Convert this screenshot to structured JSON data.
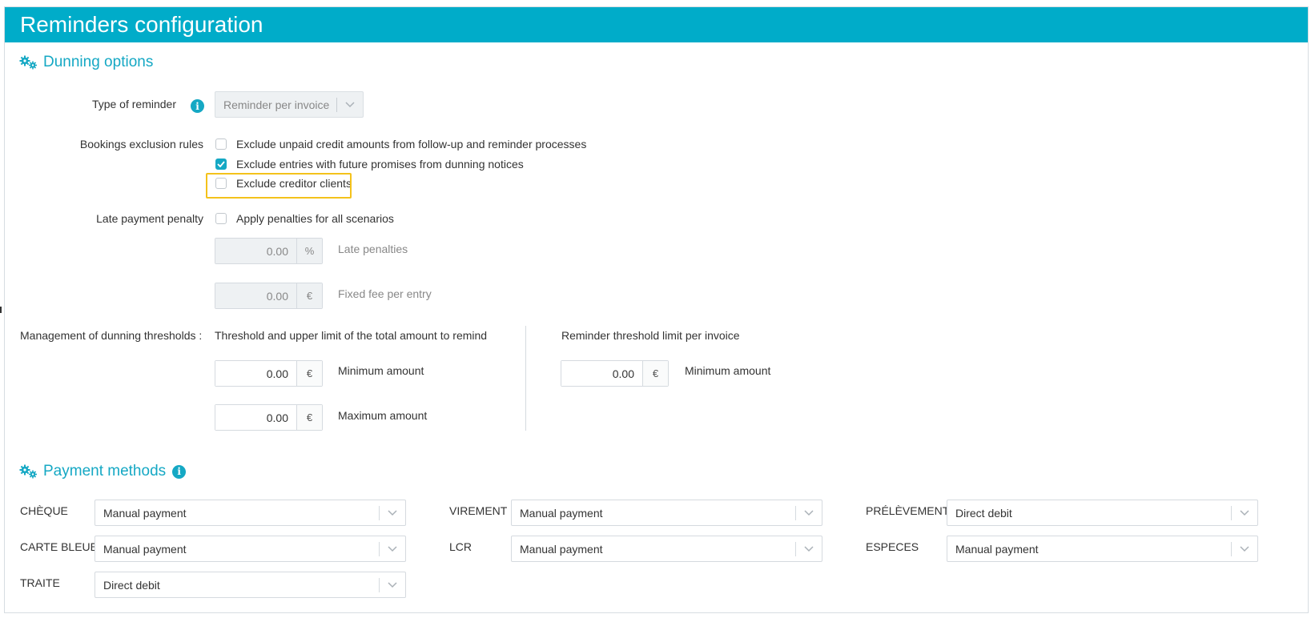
{
  "header": {
    "title": "Reminders configuration"
  },
  "dunning": {
    "section_title": "Dunning options",
    "type_of_reminder": {
      "label": "Type of reminder",
      "value": "Reminder per invoice"
    },
    "exclusion_rules": {
      "label": "Bookings exclusion rules",
      "options": [
        {
          "label": "Exclude unpaid credit amounts from follow-up and reminder processes",
          "checked": false
        },
        {
          "label": "Exclude entries with future promises from dunning notices",
          "checked": true
        },
        {
          "label": "Exclude creditor clients",
          "checked": false
        }
      ]
    },
    "late_payment": {
      "label": "Late payment penalty",
      "apply_label": "Apply penalties for all scenarios",
      "apply_checked": false,
      "late_penalties": {
        "value": "0.00",
        "unit": "%",
        "label": "Late penalties"
      },
      "fixed_fee": {
        "value": "0.00",
        "unit": "€",
        "label": "Fixed fee per entry"
      }
    },
    "thresholds": {
      "label": "Management of dunning thresholds :",
      "total": {
        "heading": "Threshold and upper limit of the total amount to remind",
        "minimum": {
          "value": "0.00",
          "unit": "€",
          "label": "Minimum amount"
        },
        "maximum": {
          "value": "0.00",
          "unit": "€",
          "label": "Maximum amount"
        }
      },
      "per_invoice": {
        "heading": "Reminder threshold limit per invoice",
        "minimum": {
          "value": "0.00",
          "unit": "€",
          "label": "Minimum amount"
        }
      }
    }
  },
  "payment_methods": {
    "section_title": "Payment methods",
    "items": [
      {
        "label": "CHÈQUE",
        "value": "Manual payment"
      },
      {
        "label": "VIREMENT",
        "value": "Manual payment"
      },
      {
        "label": "PRÉLÈVEMENT",
        "value": "Direct debit"
      },
      {
        "label": "CARTE BLEUE",
        "value": "Manual payment"
      },
      {
        "label": "LCR",
        "value": "Manual payment"
      },
      {
        "label": "ESPECES",
        "value": "Manual payment"
      },
      {
        "label": "TRAITE",
        "value": "Direct debit"
      }
    ]
  },
  "icons": {
    "accent": "#00acc9",
    "highlight": "#f4c21b",
    "names": [
      "gears-icon",
      "info-icon",
      "chevron-down-icon",
      "checkmark-icon"
    ]
  }
}
